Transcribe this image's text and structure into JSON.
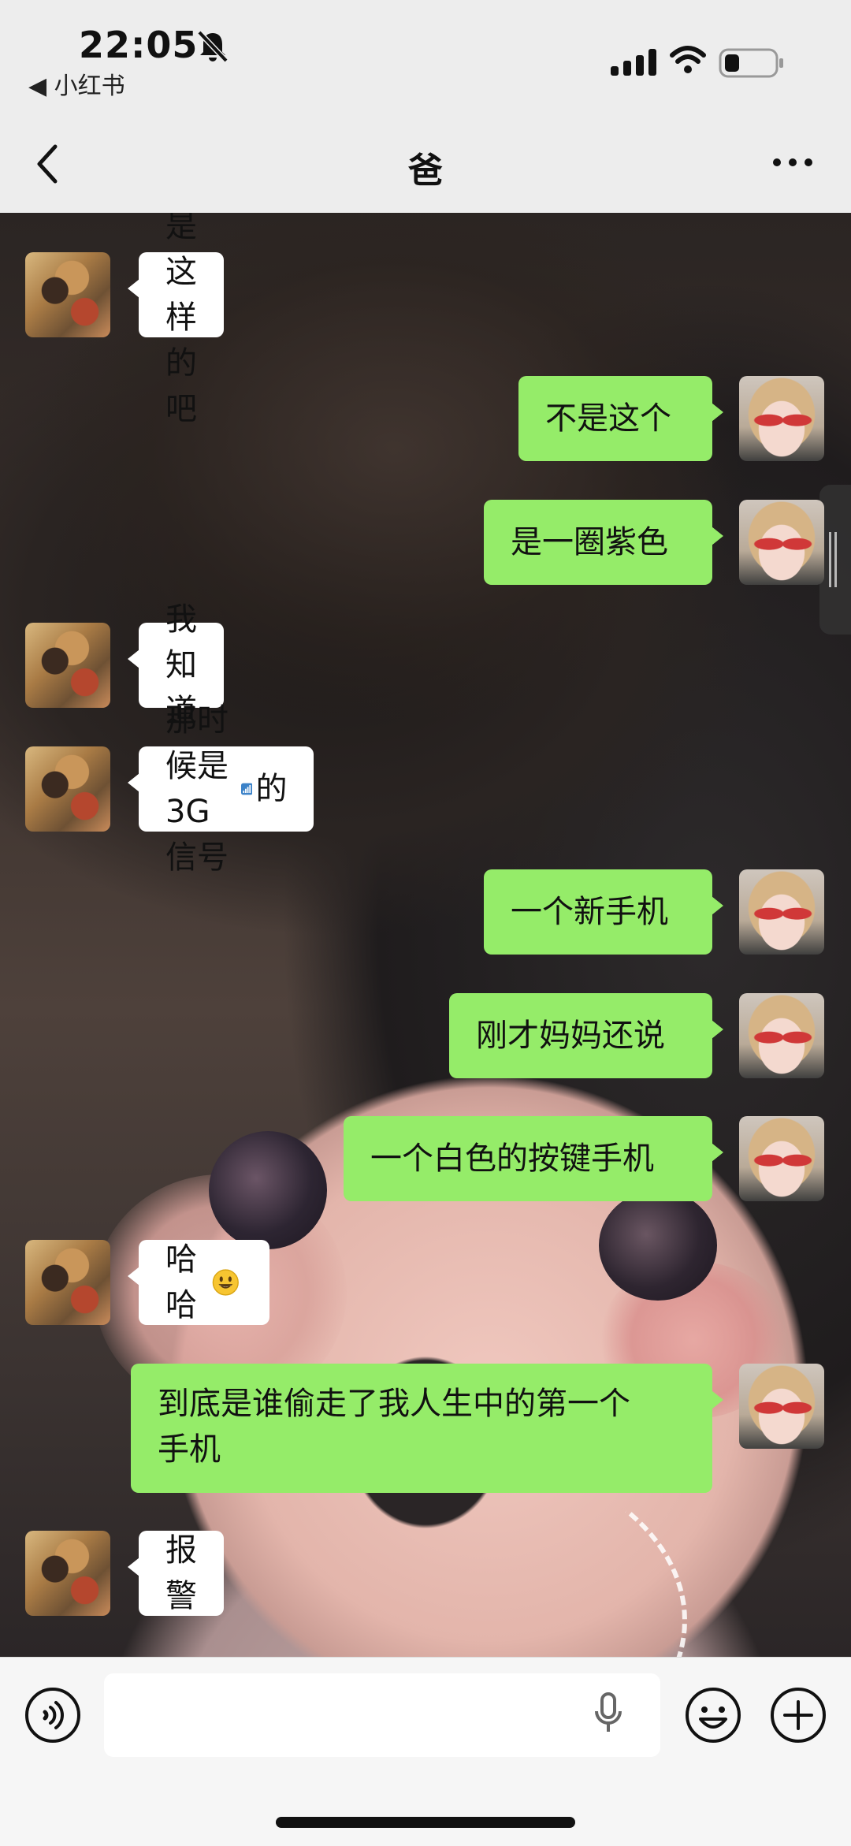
{
  "status_bar": {
    "time": "22:05",
    "back_app": "◀ 小红书",
    "icons": [
      "bell-muted-icon",
      "signal-icon",
      "wifi-icon",
      "battery-icon"
    ]
  },
  "header": {
    "title": "爸",
    "back_icon": "chevron-left-icon",
    "more_icon": "more-icon"
  },
  "messages": [
    {
      "side": "in",
      "text": "不是这样的吧"
    },
    {
      "side": "out",
      "text": "不是这个"
    },
    {
      "side": "out",
      "text": "是一圈紫色"
    },
    {
      "side": "in",
      "text": "我知道"
    },
    {
      "side": "in",
      "text_before": "那时候是 3G信号",
      "emoji": "signal-bars-emoji",
      "text_after": "的"
    },
    {
      "side": "out",
      "text": "一个新手机"
    },
    {
      "side": "out",
      "text": "刚才妈妈还说"
    },
    {
      "side": "out",
      "text": "一个白色的按键手机"
    },
    {
      "side": "in",
      "text": "哈哈",
      "emoji": "smile-emoji"
    },
    {
      "side": "out",
      "line1": "到底是谁偷走了我人生中的第一个",
      "line2": "手机"
    },
    {
      "side": "in",
      "text": "报警"
    }
  ],
  "input_bar": {
    "voice_icon": "voice-icon",
    "mic_icon": "mic-icon",
    "emoji_icon": "emoji-icon",
    "plus_icon": "plus-icon",
    "input_value": ""
  },
  "colors": {
    "outgoing_bubble": "#95ec69",
    "incoming_bubble": "#ffffff",
    "header_bg": "#ededed"
  }
}
